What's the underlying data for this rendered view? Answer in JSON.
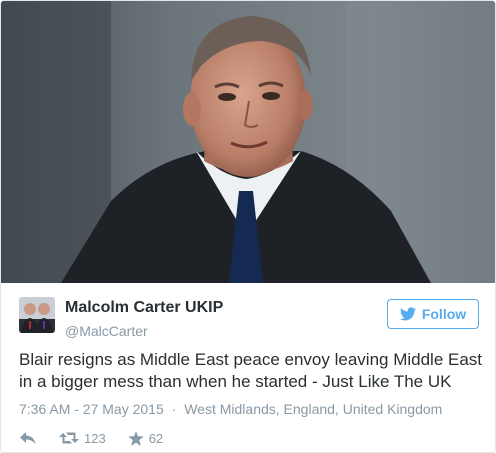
{
  "tweet": {
    "author": {
      "display_name": "Malcolm Carter UKIP",
      "screen_name": "@MalcCarter",
      "avatar_icon": "profile-photo"
    },
    "follow_label": "Follow",
    "follow_icon": "twitter-bird-icon",
    "text": "Blair resigns as Middle East peace envoy leaving Middle East in a bigger mess than when he started - Just Like The UK",
    "timestamp": "7:36 AM - 27 May 2015",
    "separator": "·",
    "location": "West Midlands, England, United Kingdom",
    "stats": {
      "retweets": "123",
      "likes": "62"
    },
    "colors": {
      "accent": "#55acee",
      "text": "#292f33",
      "muted": "#8899a6"
    }
  }
}
